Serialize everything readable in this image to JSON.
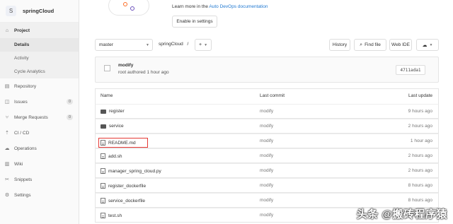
{
  "project": {
    "avatar_letter": "S",
    "name": "springCloud"
  },
  "sidebar": {
    "project_label": "Project",
    "sub_items": [
      "Details",
      "Activity",
      "Cycle Analytics"
    ],
    "items": [
      {
        "label": "Repository",
        "icon": "book-icon"
      },
      {
        "label": "Issues",
        "icon": "issues-icon",
        "badge": "0"
      },
      {
        "label": "Merge Requests",
        "icon": "merge-request-icon",
        "badge": "0"
      },
      {
        "label": "CI / CD",
        "icon": "rocket-icon"
      },
      {
        "label": "Operations",
        "icon": "cloud-icon"
      },
      {
        "label": "Wiki",
        "icon": "book-icon"
      },
      {
        "label": "Snippets",
        "icon": "scissors-icon"
      },
      {
        "label": "Settings",
        "icon": "gear-icon"
      }
    ]
  },
  "banner": {
    "text": "Learn more in the",
    "link": "Auto DevOps documentation",
    "enable_button": "Enable in settings"
  },
  "toolbar": {
    "branch": "master",
    "breadcrumb": "springCloud",
    "separator": "/",
    "plus": "+",
    "history": "History",
    "find_file": "Find file",
    "web_ide": "Web IDE"
  },
  "commit": {
    "title": "modify",
    "author_line": "root authored 1 hour ago",
    "sha": "4711ada1"
  },
  "table": {
    "headers": {
      "name": "Name",
      "last_commit": "Last commit",
      "last_update": "Last update"
    },
    "rows": [
      {
        "name": "register",
        "type": "folder",
        "commit": "modify",
        "update": "9 hours ago"
      },
      {
        "name": "service",
        "type": "folder",
        "commit": "modify",
        "update": "2 hours ago"
      },
      {
        "name": "README.md",
        "type": "file",
        "commit": "modify",
        "update": "1 hour ago",
        "highlight": true
      },
      {
        "name": "add.sh",
        "type": "file",
        "commit": "modify",
        "update": "2 hours ago"
      },
      {
        "name": "manager_spring_cloud.py",
        "type": "file",
        "commit": "modify",
        "update": "2 hours ago"
      },
      {
        "name": "register_dockerfile",
        "type": "file",
        "commit": "modify",
        "update": "8 hours ago"
      },
      {
        "name": "service_dockerfile",
        "type": "file",
        "commit": "modify",
        "update": "8 hours ago"
      },
      {
        "name": "test.sh",
        "type": "file",
        "commit": "modify",
        "update": "2 hours ago"
      }
    ]
  },
  "watermark": "头条 @搬砖程序猿",
  "colors": {
    "link": "#1f78d1",
    "highlight_box": "#e53935"
  }
}
